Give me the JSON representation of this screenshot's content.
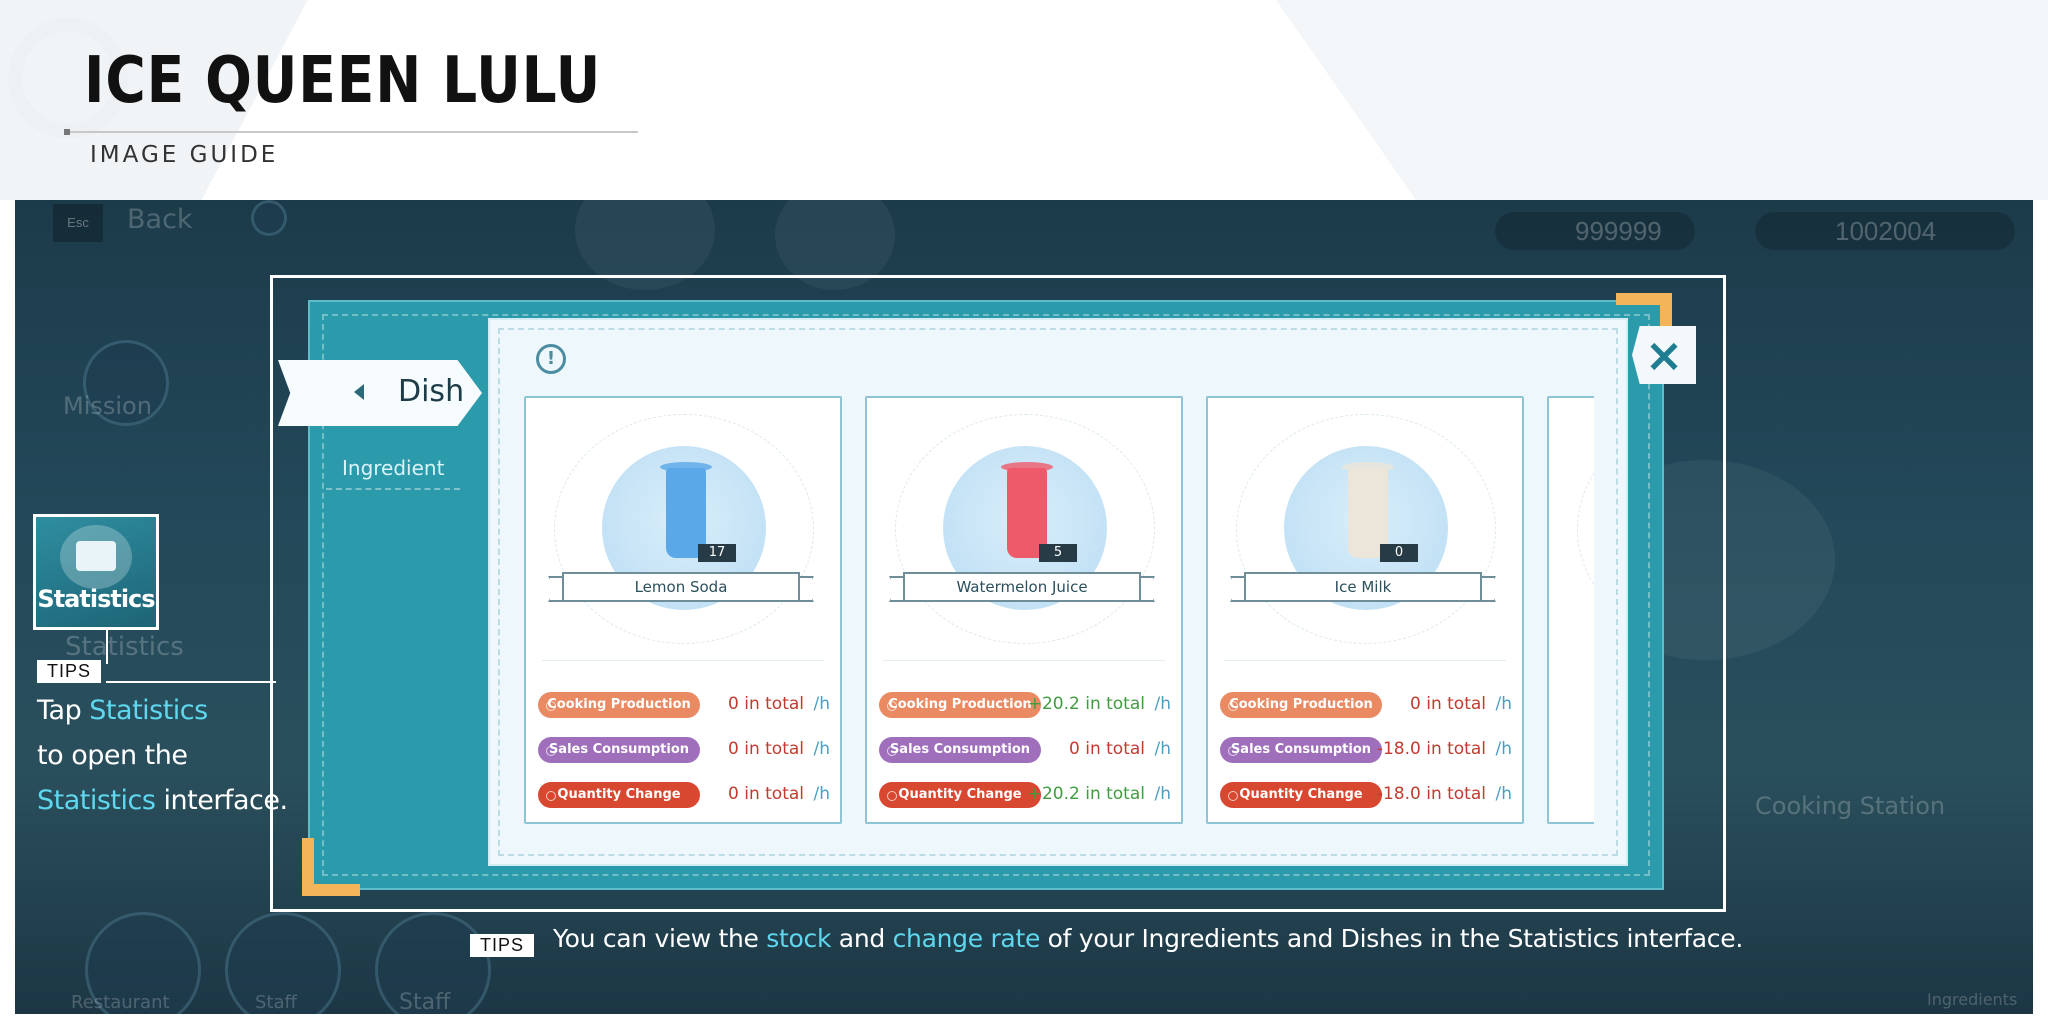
{
  "header": {
    "title": "ICE QUEEN LULU",
    "subtitle": "IMAGE GUIDE"
  },
  "background_ui": {
    "esc_label": "Esc",
    "back_label": "Back",
    "currency_1": "999999",
    "currency_2": "1002004",
    "mission_label": "Mission",
    "statistics_bg_label": "Statistics",
    "cooking_station_label": "Cooking Station",
    "bottom_labels": [
      "Restaurant",
      "Staff",
      "Staff",
      "Ingredients"
    ]
  },
  "statistics_button": {
    "label": "Statistics"
  },
  "tips_left": {
    "tag": "TIPS",
    "line1_prefix": "Tap ",
    "line1_highlight": "Statistics",
    "line2": "to open the",
    "line3_highlight": "Statistics",
    "line3_suffix": " interface."
  },
  "dialog": {
    "tabs": {
      "dish": "Dish",
      "ingredient": "Ingredient"
    },
    "info_icon": "!",
    "close_icon": "×",
    "cards": [
      {
        "name": "Lemon Soda",
        "count": "17",
        "cooking_production_label": "Cooking Production",
        "cooking_production_value": "0 in total",
        "sales_consumption_label": "Sales Consumption",
        "sales_consumption_value": "0 in total",
        "quantity_change_label": "Quantity Change",
        "quantity_change_value": "0 in total",
        "unit": "/h",
        "drink_color": "#5aa8e8"
      },
      {
        "name": "Watermelon Juice",
        "count": "5",
        "cooking_production_label": "Cooking Production",
        "cooking_production_value": "+20.2 in total",
        "sales_consumption_label": "Sales Consumption",
        "sales_consumption_value": "0 in total",
        "quantity_change_label": "Quantity Change",
        "quantity_change_value": "+20.2 in total",
        "unit": "/h",
        "drink_color": "#ef5a6a"
      },
      {
        "name": "Ice Milk",
        "count": "0",
        "cooking_production_label": "Cooking Production",
        "cooking_production_value": "0 in total",
        "sales_consumption_label": "Sales Consumption",
        "sales_consumption_value": "-18.0 in total",
        "quantity_change_label": "Quantity Change",
        "quantity_change_value": "-18.0 in total",
        "unit": "/h",
        "drink_color": "#ece6da"
      }
    ]
  },
  "tips_bottom": {
    "tag": "TIPS",
    "t1": "You can view the ",
    "h1": "stock",
    "t2": " and ",
    "h2": "change rate",
    "t3": " of your Ingredients and Dishes in the Statistics interface."
  },
  "colors": {
    "highlight": "#5fd8ef",
    "panel_teal": "#2b9aab",
    "corner_orange": "#f3b45a",
    "pill_cooking": "#e98a63",
    "pill_sales": "#a06fbc",
    "pill_quantity": "#d8472f",
    "value_red": "#c23b2e",
    "value_green": "#3f9d3f"
  }
}
